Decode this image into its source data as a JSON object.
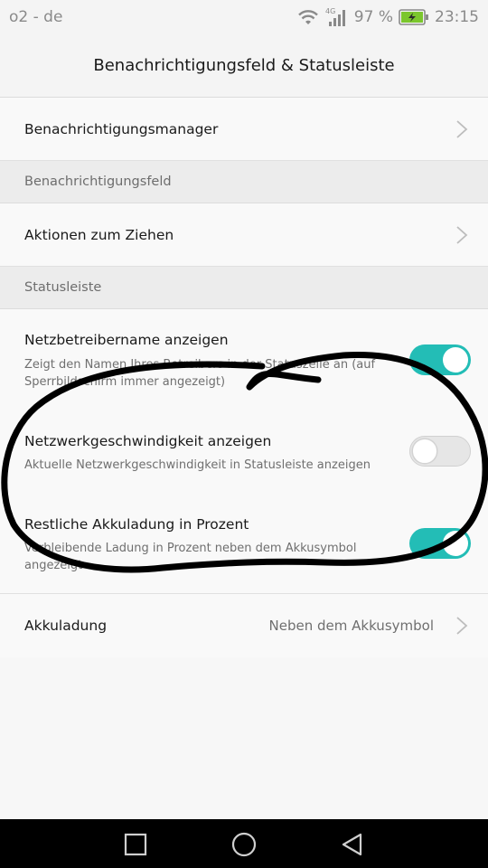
{
  "status_bar": {
    "carrier": "o2 - de",
    "network_type": "4G",
    "battery_percent": "97 %",
    "time": "23:15",
    "icons": [
      "wifi-icon",
      "signal-icon",
      "battery-charging-icon"
    ]
  },
  "header": {
    "title": "Benachrichtigungsfeld & Statusleiste"
  },
  "items": {
    "notification_manager": {
      "label": "Benachrichtigungsmanager"
    },
    "section_notification_panel": "Benachrichtigungsfeld",
    "pull_actions": {
      "label": "Aktionen zum Ziehen"
    },
    "section_status_bar": "Statusleiste",
    "carrier_name": {
      "label": "Netzbetreibername anzeigen",
      "desc": "Zeigt den Namen Ihres Betreibers in der Statuszeile an (auf Sperrbildschirm immer angezeigt)",
      "enabled": true
    },
    "network_speed": {
      "label": "Netzwerkgeschwindigkeit anzeigen",
      "desc": "Aktuelle Netzwerkgeschwindigkeit in Statusleiste anzeigen",
      "enabled": false
    },
    "battery_percent": {
      "label": "Restliche Akkuladung in Prozent",
      "desc": "Verbleibende Ladung in Prozent neben dem Akkusymbol angezeigt",
      "enabled": true
    },
    "battery_display": {
      "label": "Akkuladung",
      "value": "Neben dem Akkusymbol"
    }
  },
  "nav_bar": {
    "buttons": [
      "recent-apps-icon",
      "home-icon",
      "back-icon"
    ]
  },
  "colors": {
    "accent": "#23bdb6",
    "background": "#f7f7f7",
    "section_bg": "#ececec",
    "nav_bg": "#000000"
  }
}
